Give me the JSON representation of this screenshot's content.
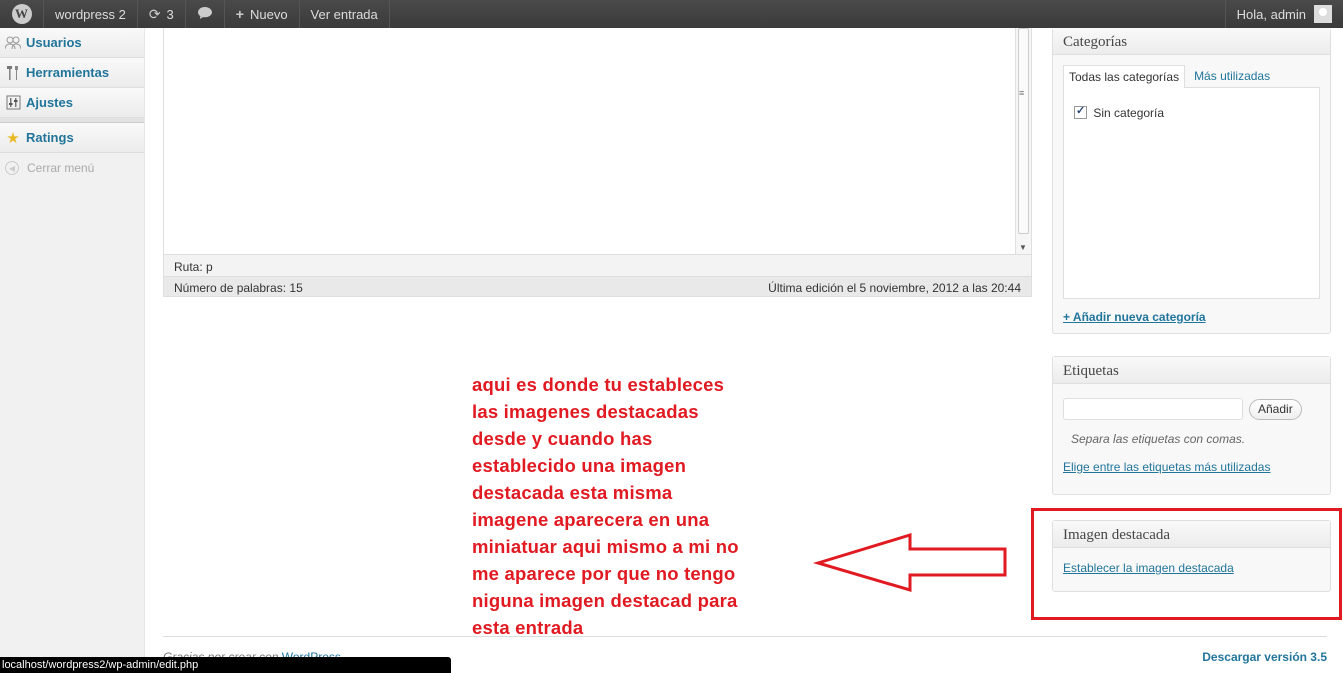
{
  "adminbar": {
    "site_name": "wordpress 2",
    "updates_count": "3",
    "new_label": "Nuevo",
    "view_label": "Ver entrada",
    "greeting": "Hola, admin"
  },
  "sidebar": {
    "items": [
      {
        "label": "Usuarios",
        "icon": "users-icon"
      },
      {
        "label": "Herramientas",
        "icon": "tools-icon"
      },
      {
        "label": "Ajustes",
        "icon": "settings-icon"
      },
      {
        "label": "Ratings",
        "icon": "star-icon"
      }
    ],
    "collapse_label": "Cerrar menú"
  },
  "editor": {
    "path_label": "Ruta:",
    "path_value": "p",
    "word_count": "Número de palabras: 15",
    "last_edit": "Última edición el 5 noviembre, 2012 a las 20:44"
  },
  "categorias": {
    "title": "Categorías",
    "tab_all": "Todas las categorías",
    "tab_popular": "Más utilizadas",
    "items": [
      {
        "label": "Sin categoría",
        "checked": true
      }
    ],
    "add_link": "+ Añadir nueva categoría"
  },
  "etiquetas": {
    "title": "Etiquetas",
    "add_button": "Añadir",
    "hint": "Separa las etiquetas con comas.",
    "choose_link": "Elige entre las etiquetas más utilizadas"
  },
  "imagen": {
    "title": "Imagen destacada",
    "set_link": "Establecer la imagen destacada"
  },
  "annotation": {
    "lines": [
      "aqui es donde tu estableces",
      "las imagenes destacadas",
      "desde y cuando has",
      "establecido una imagen",
      "destacada esta misma",
      "imagene aparecera en una",
      "miniatuar aqui mismo a mi no",
      "me aparece por que no tengo",
      "niguna imagen destacad para",
      "esta entrada"
    ],
    "color": "#e11a22"
  },
  "footer": {
    "thanks_text": "Gracias por crear con",
    "wp_link": "WordPress",
    "download": "Descargar versión 3.5"
  },
  "statusbar": {
    "url": "localhost/wordpress2/wp-admin/edit.php"
  }
}
